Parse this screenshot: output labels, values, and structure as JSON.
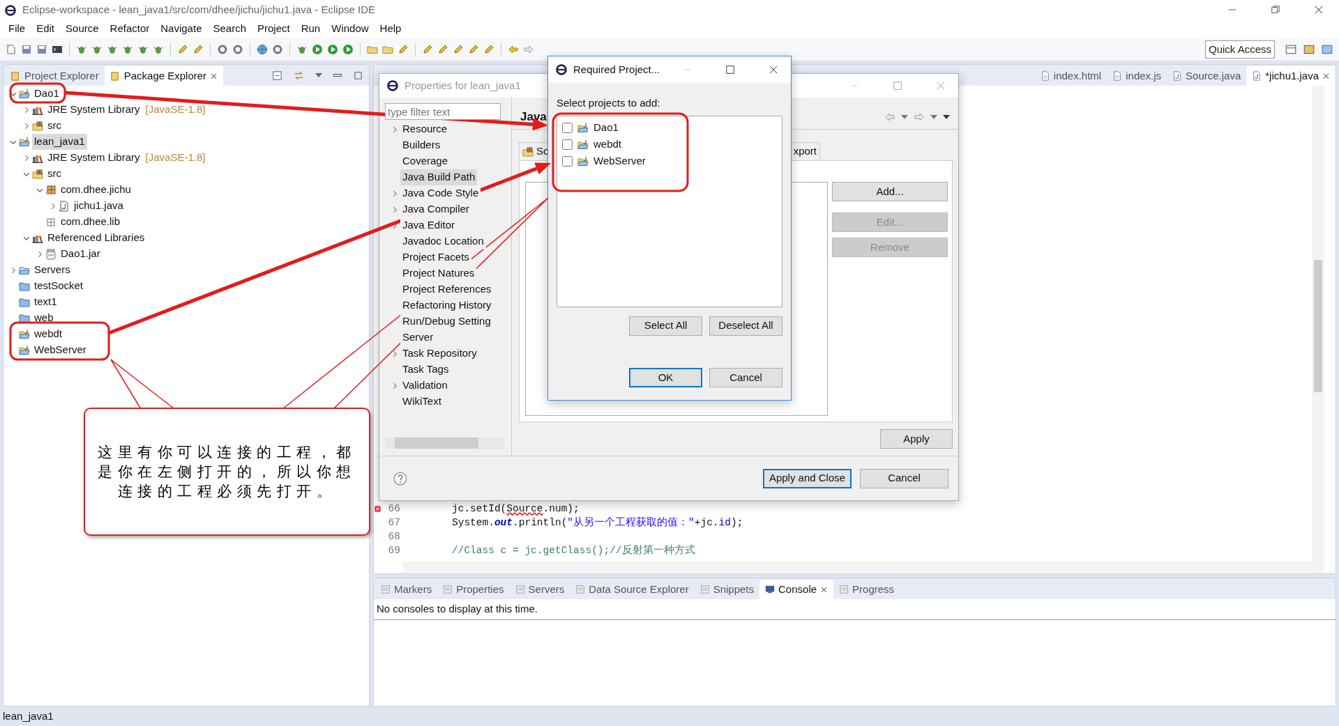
{
  "window": {
    "title": "Eclipse-workspace - lean_java1/src/com/dhee/jichu/jichu1.java - Eclipse IDE"
  },
  "menu": [
    "File",
    "Edit",
    "Source",
    "Refactor",
    "Navigate",
    "Search",
    "Project",
    "Run",
    "Window",
    "Help"
  ],
  "toolbar": {
    "quick_access": {
      "placeholder": "Quick Access"
    }
  },
  "explorer": {
    "tabs": [
      {
        "label": "Project Explorer",
        "selected": false
      },
      {
        "label": "Package Explorer",
        "selected": true
      }
    ],
    "tree": [
      {
        "label": "Dao1",
        "kind": "project",
        "expanded": true,
        "selected": false,
        "children": [
          {
            "label": "JRE System Library",
            "decoration": "[JavaSE-1.8]",
            "kind": "library",
            "expanded": false,
            "selected": false
          },
          {
            "label": "src",
            "kind": "source_folder",
            "expanded": false,
            "selected": false
          }
        ]
      },
      {
        "label": "lean_java1",
        "kind": "project",
        "expanded": true,
        "selected": true,
        "children": [
          {
            "label": "JRE System Library",
            "decoration": "[JavaSE-1.8]",
            "kind": "library",
            "expanded": false,
            "selected": false
          },
          {
            "label": "src",
            "kind": "source_folder",
            "expanded": true,
            "selected": false,
            "children": [
              {
                "label": "com.dhee.jichu",
                "kind": "package",
                "expanded": true,
                "selected": false,
                "children": [
                  {
                    "label": "jichu1.java",
                    "kind": "java_file",
                    "expanded": false,
                    "selected": false
                  }
                ]
              },
              {
                "label": "com.dhee.lib",
                "kind": "empty_package",
                "selected": false
              }
            ]
          },
          {
            "label": "Referenced Libraries",
            "kind": "library",
            "expanded": true,
            "selected": false,
            "children": [
              {
                "label": "Dao1.jar",
                "kind": "jar",
                "expanded": false,
                "selected": false
              }
            ]
          }
        ]
      },
      {
        "label": "Servers",
        "kind": "folder",
        "expanded": false,
        "selected": false
      },
      {
        "label": "testSocket",
        "kind": "closed_project",
        "selected": false
      },
      {
        "label": "text1",
        "kind": "closed_project",
        "selected": false
      },
      {
        "label": "web",
        "kind": "closed_project",
        "selected": false
      },
      {
        "label": "webdt",
        "kind": "project",
        "selected": false
      },
      {
        "label": "WebServer",
        "kind": "project",
        "selected": false
      }
    ]
  },
  "editor": {
    "tabs": [
      {
        "label": "index.html",
        "kind": "html",
        "selected": false
      },
      {
        "label": "index.js",
        "kind": "js",
        "selected": false
      },
      {
        "label": "Source.java",
        "kind": "java",
        "selected": false
      },
      {
        "label": "*jichu1.java",
        "kind": "java",
        "selected": true
      }
    ],
    "lines": [
      {
        "number": "66",
        "error_marker": true,
        "segments": [
          {
            "text": "jc.setId(",
            "kind": "plain"
          },
          {
            "text": "Source",
            "kind": "error"
          },
          {
            "text": ".num);",
            "kind": "plain"
          }
        ]
      },
      {
        "number": "67",
        "error_marker": false,
        "segments": [
          {
            "text": "System.",
            "kind": "plain"
          },
          {
            "text": "out",
            "kind": "static"
          },
          {
            "text": ".println(",
            "kind": "plain"
          },
          {
            "text": "\"从另一个工程获取的值：\"",
            "kind": "string"
          },
          {
            "text": "+jc.",
            "kind": "plain"
          },
          {
            "text": "id",
            "kind": "field"
          },
          {
            "text": ");",
            "kind": "plain"
          }
        ]
      },
      {
        "number": "68",
        "error_marker": false
      },
      {
        "number": "69",
        "error_marker": false,
        "segments": [
          {
            "text": "//Class c = jc.getClass();//反射第一种方式",
            "kind": "comment"
          }
        ]
      }
    ]
  },
  "bottom_panel": {
    "tabs": [
      {
        "label": "Markers",
        "selected": false
      },
      {
        "label": "Properties",
        "selected": false
      },
      {
        "label": "Servers",
        "selected": false
      },
      {
        "label": "Data Source Explorer",
        "selected": false
      },
      {
        "label": "Snippets",
        "selected": false
      },
      {
        "label": "Console",
        "selected": true
      },
      {
        "label": "Progress",
        "selected": false
      }
    ],
    "message": "No consoles to display at this time."
  },
  "status_bar": {
    "text": "lean_java1"
  },
  "properties_dialog": {
    "title": "Properties for lean_java1",
    "filter": {
      "placeholder": "type filter text"
    },
    "pages": [
      {
        "label": "Resource",
        "expanded": false,
        "selected": false
      },
      {
        "label": "Builders",
        "selected": false
      },
      {
        "label": "Coverage",
        "selected": false
      },
      {
        "label": "Java Build Path",
        "selected": true
      },
      {
        "label": "Java Code Style",
        "expanded": false,
        "selected": false
      },
      {
        "label": "Java Compiler",
        "expanded": false,
        "selected": false
      },
      {
        "label": "Java Editor",
        "expanded": false,
        "selected": false
      },
      {
        "label": "Javadoc Location",
        "selected": false
      },
      {
        "label": "Project Facets",
        "selected": false
      },
      {
        "label": "Project Natures",
        "selected": false
      },
      {
        "label": "Project References",
        "selected": false
      },
      {
        "label": "Refactoring History",
        "selected": false
      },
      {
        "label": "Run/Debug Setting",
        "selected": false
      },
      {
        "label": "Server",
        "selected": false
      },
      {
        "label": "Task Repository",
        "expanded": false,
        "selected": false
      },
      {
        "label": "Task Tags",
        "selected": false
      },
      {
        "label": "Validation",
        "expanded": false,
        "selected": false
      },
      {
        "label": "WikiText",
        "selected": false
      }
    ],
    "heading": "Java",
    "tabs": [
      {
        "label": "Sc"
      },
      {
        "label": "xport"
      }
    ],
    "side_buttons": [
      {
        "label": "Add...",
        "disabled": false
      },
      {
        "label": "Edit...",
        "disabled": true
      },
      {
        "label": "Remove",
        "disabled": true
      }
    ],
    "apply": "Apply",
    "buttons": [
      {
        "label": "Apply and Close",
        "default": true
      },
      {
        "label": "Cancel",
        "default": false
      }
    ]
  },
  "required_dialog": {
    "title": "Required Project...",
    "prompt": "Select projects to add:",
    "projects": [
      {
        "name": "Dao1",
        "checked": false
      },
      {
        "name": "webdt",
        "checked": false
      },
      {
        "name": "WebServer",
        "checked": false
      }
    ],
    "select_buttons": [
      "Select All",
      "Deselect All"
    ],
    "buttons": [
      {
        "label": "OK",
        "default": true
      },
      {
        "label": "Cancel",
        "default": false
      }
    ]
  },
  "annotation": {
    "callout": "这里有你可以连接的工程，都是你在左侧打开的，所以你想连接的工程必须先打开。"
  }
}
